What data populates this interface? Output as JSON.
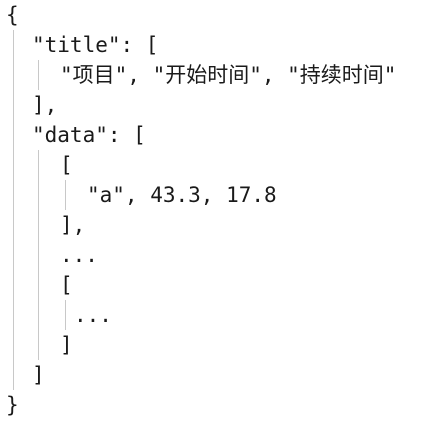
{
  "lines": [
    "{",
    "\"title\": [",
    "\"项目\", \"开始时间\", \"持续时间\"",
    "],",
    "\"data\": [",
    "[",
    "\"a\", 43.3, 17.8",
    "],",
    "...",
    "[",
    "...",
    "]",
    "]",
    "}"
  ]
}
